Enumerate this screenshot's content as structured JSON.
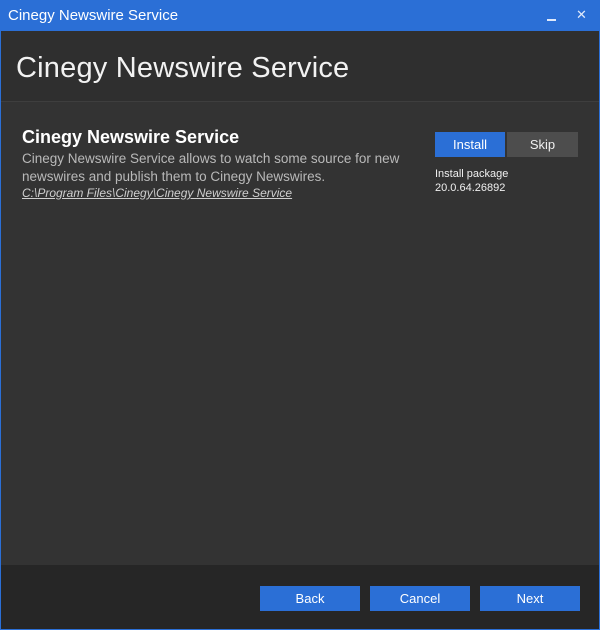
{
  "window": {
    "title": "Cinegy Newswire Service",
    "accent_color": "#2b6fd6",
    "controls": {
      "minimize_icon": "minimize-icon",
      "close_glyph": "✕"
    }
  },
  "header": {
    "title": "Cinegy Newswire Service"
  },
  "product": {
    "name": "Cinegy Newswire Service",
    "description": "Cinegy Newswire Service allows to watch some source for new newswires and publish them to Cinegy Newswires.",
    "install_path": "C:\\Program Files\\Cinegy\\Cinegy Newswire Service",
    "install_label": "Install",
    "skip_label": "Skip",
    "package_label": "Install package",
    "package_version": "20.0.64.26892"
  },
  "footer": {
    "back_label": "Back",
    "cancel_label": "Cancel",
    "next_label": "Next"
  }
}
